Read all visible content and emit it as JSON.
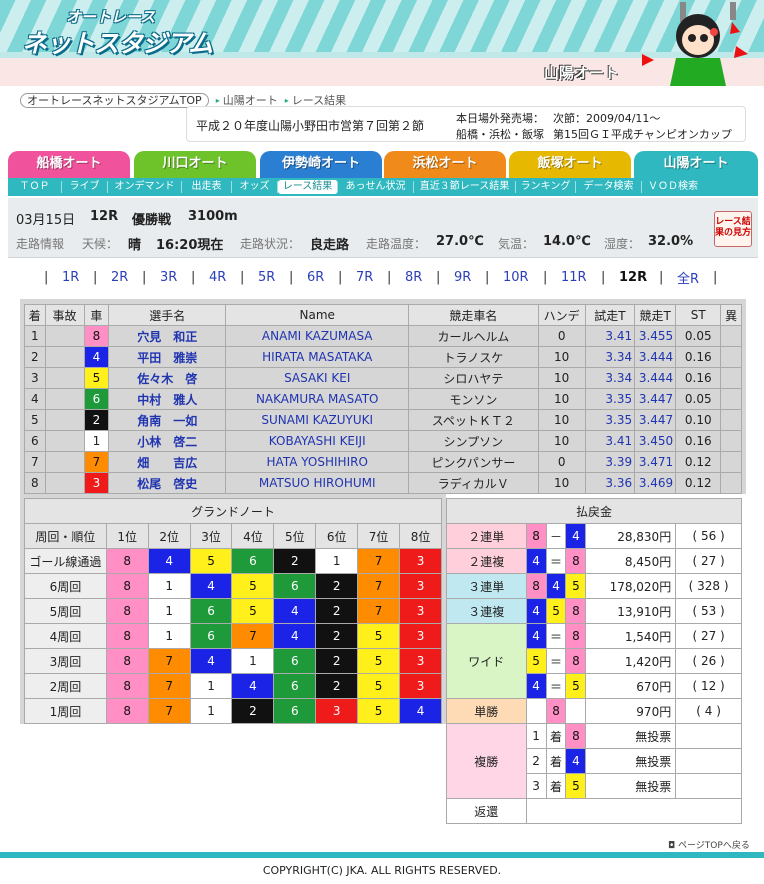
{
  "header": {
    "logo_top": "オートレース",
    "logo_main": "ネットスタジアム",
    "venue_tag": "山陽オート"
  },
  "breadcrumb": {
    "home": "オートレースネットスタジアムTOP",
    "venue": "山陽オート",
    "page": "レース結果"
  },
  "event": {
    "title": "平成２０年度山陽小野田市営第７回第２節",
    "sales_label": "本日場外発売場：",
    "sales_value": "次節：2009/04/11～",
    "sales_venues": "船橋・浜松・飯塚",
    "next_event": "第15回ＧＩ平成チャンピオンカップ"
  },
  "venue_tabs": [
    {
      "label": "船橋オート",
      "color": "#f0529b"
    },
    {
      "label": "川口オート",
      "color": "#6ec32b"
    },
    {
      "label": "伊勢崎オート",
      "color": "#2a7fd2"
    },
    {
      "label": "浜松オート",
      "color": "#f08a1a"
    },
    {
      "label": "飯塚オート",
      "color": "#e6b800"
    },
    {
      "label": "山陽オート",
      "color": "#2fb8bf"
    }
  ],
  "subnav": [
    "ＴＯＰ",
    "ライブ",
    "オンデマンド",
    "出走表",
    "オッズ",
    "レース結果",
    "あっせん状況",
    "直近３節レース結果",
    "ランキング",
    "データ検索",
    "ＶＯＤ検索"
  ],
  "race": {
    "date": "03月15日",
    "race_no": "12R",
    "race_name": "優勝戦",
    "distance": "3100m",
    "cond_label": "走路情報",
    "weather_label": "天候：",
    "weather": "晴",
    "time": "16:20現在",
    "track_label": "走路状況：",
    "track": "良走路",
    "temp_label": "走路温度：",
    "temp": "27.0℃",
    "air_label": "気温：",
    "air": "14.0℃",
    "hum_label": "湿度：",
    "hum": "32.0%",
    "guide_button": "レース結果の見方"
  },
  "race_nav": [
    "1R",
    "2R",
    "3R",
    "4R",
    "5R",
    "6R",
    "7R",
    "8R",
    "9R",
    "10R",
    "11R",
    "12R",
    "全R"
  ],
  "results": {
    "headers": [
      "着",
      "事故",
      "車",
      "選手名",
      "Name",
      "競走車名",
      "ハンデ",
      "試走T",
      "競走T",
      "ST",
      "異"
    ],
    "rows": [
      {
        "place": "1",
        "accident": "",
        "car": "8",
        "name": "穴見　和正",
        "ename": "ANAMI KAZUMASA",
        "bike": "カールヘルム",
        "handicap": "0",
        "trial": "3.41",
        "race_t": "3.455",
        "st": "0.05",
        "other": ""
      },
      {
        "place": "2",
        "accident": "",
        "car": "4",
        "name": "平田　雅崇",
        "ename": "HIRATA MASATAKA",
        "bike": "トラノスケ",
        "handicap": "10",
        "trial": "3.34",
        "race_t": "3.444",
        "st": "0.16",
        "other": ""
      },
      {
        "place": "3",
        "accident": "",
        "car": "5",
        "name": "佐々木　啓",
        "ename": "SASAKI KEI",
        "bike": "シロハヤテ",
        "handicap": "10",
        "trial": "3.34",
        "race_t": "3.444",
        "st": "0.16",
        "other": ""
      },
      {
        "place": "4",
        "accident": "",
        "car": "6",
        "name": "中村　雅人",
        "ename": "NAKAMURA MASATO",
        "bike": "モンソン",
        "handicap": "10",
        "trial": "3.35",
        "race_t": "3.447",
        "st": "0.05",
        "other": ""
      },
      {
        "place": "5",
        "accident": "",
        "car": "2",
        "name": "角南　一如",
        "ename": "SUNAMI KAZUYUKI",
        "bike": "スペットＫＴ２",
        "handicap": "10",
        "trial": "3.35",
        "race_t": "3.447",
        "st": "0.10",
        "other": ""
      },
      {
        "place": "6",
        "accident": "",
        "car": "1",
        "name": "小林　啓二",
        "ename": "KOBAYASHI KEIJI",
        "bike": "シンプソン",
        "handicap": "10",
        "trial": "3.41",
        "race_t": "3.450",
        "st": "0.16",
        "other": ""
      },
      {
        "place": "7",
        "accident": "",
        "car": "7",
        "name": "畑　　吉広",
        "ename": "HATA YOSHIHIRO",
        "bike": "ピンクパンサー",
        "handicap": "0",
        "trial": "3.39",
        "race_t": "3.471",
        "st": "0.12",
        "other": ""
      },
      {
        "place": "8",
        "accident": "",
        "car": "3",
        "name": "松尾　啓史",
        "ename": "MATSUO HIROHUMI",
        "bike": "ラディカルＶ",
        "handicap": "10",
        "trial": "3.36",
        "race_t": "3.469",
        "st": "0.12",
        "other": ""
      }
    ]
  },
  "grand_note": {
    "title": "グランドノート",
    "headers": [
      "周回・順位",
      "1位",
      "2位",
      "3位",
      "4位",
      "5位",
      "6位",
      "7位",
      "8位"
    ],
    "rows": [
      {
        "label": "ゴール線通過",
        "cars": [
          "8",
          "4",
          "5",
          "6",
          "2",
          "1",
          "7",
          "3"
        ]
      },
      {
        "label": "6周回",
        "cars": [
          "8",
          "1",
          "4",
          "5",
          "6",
          "2",
          "7",
          "3"
        ]
      },
      {
        "label": "5周回",
        "cars": [
          "8",
          "1",
          "6",
          "5",
          "4",
          "2",
          "7",
          "3"
        ]
      },
      {
        "label": "4周回",
        "cars": [
          "8",
          "1",
          "6",
          "7",
          "4",
          "2",
          "5",
          "3"
        ]
      },
      {
        "label": "3周回",
        "cars": [
          "8",
          "7",
          "4",
          "1",
          "6",
          "2",
          "5",
          "3"
        ]
      },
      {
        "label": "2周回",
        "cars": [
          "8",
          "7",
          "1",
          "4",
          "6",
          "2",
          "5",
          "3"
        ]
      },
      {
        "label": "1周回",
        "cars": [
          "8",
          "7",
          "1",
          "2",
          "6",
          "3",
          "5",
          "4"
        ]
      }
    ]
  },
  "payout": {
    "title": "払戻金",
    "exacta_label": "２連単",
    "exacta_a": "8",
    "exacta_sep": "－",
    "exacta_b": "4",
    "exacta_yen": "28,830円",
    "exacta_pop": "( 56 )",
    "quinella_label": "２連複",
    "quinella_a": "4",
    "quinella_sep": "＝",
    "quinella_b": "8",
    "quinella_yen": "8,450円",
    "quinella_pop": "( 27 )",
    "trifecta_label": "３連単",
    "trifecta_a": "8",
    "trifecta_b": "4",
    "trifecta_c": "5",
    "trifecta_yen": "178,020円",
    "trifecta_pop": "( 328 )",
    "trio_label": "３連複",
    "trio_a": "4",
    "trio_b": "5",
    "trio_c": "8",
    "trio_yen": "13,910円",
    "trio_pop": "( 53 )",
    "wide_label": "ワイド",
    "wide": [
      {
        "a": "4",
        "sep": "＝",
        "b": "8",
        "yen": "1,540円",
        "pop": "( 27 )"
      },
      {
        "a": "5",
        "sep": "＝",
        "b": "8",
        "yen": "1,420円",
        "pop": "( 26 )"
      },
      {
        "a": "4",
        "sep": "＝",
        "b": "5",
        "yen": "670円",
        "pop": "( 12 )"
      }
    ],
    "win_label": "単勝",
    "win_car": "8",
    "win_yen": "970円",
    "win_pop": "( 4 )",
    "place_label": "複勝",
    "place": [
      {
        "rank": "1",
        "unit": "着",
        "car": "8",
        "yen": "無投票"
      },
      {
        "rank": "2",
        "unit": "着",
        "car": "4",
        "yen": "無投票"
      },
      {
        "rank": "3",
        "unit": "着",
        "car": "5",
        "yen": "無投票"
      }
    ],
    "refund_label": "返還",
    "refund_value": ""
  },
  "footer": {
    "pagetop": "ページTOPへ戻る",
    "copyright": "COPYRIGHT(C) JKA. ALL RIGHTS RESERVED."
  }
}
